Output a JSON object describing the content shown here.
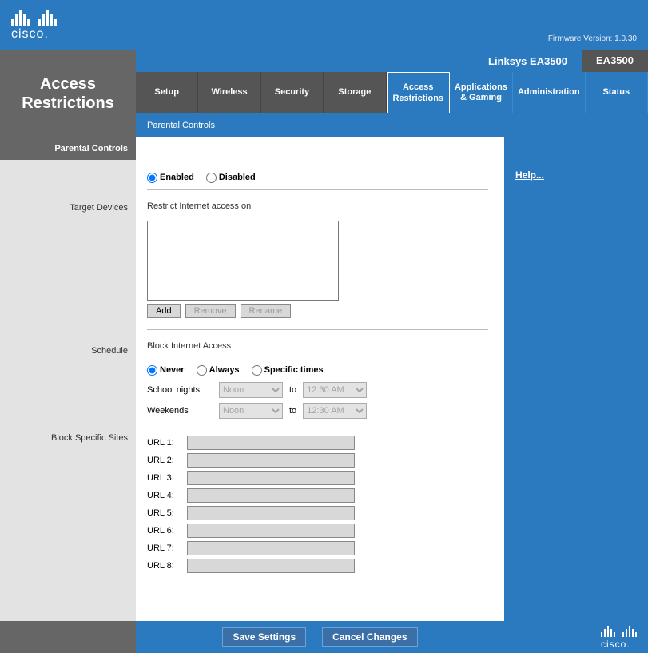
{
  "brand": {
    "name": "cisco."
  },
  "firmware": "Firmware Version: 1.0.30",
  "page_title": "Access Restrictions",
  "model": {
    "name": "Linksys EA3500",
    "code": "EA3500"
  },
  "tabs": {
    "setup": "Setup",
    "wireless": "Wireless",
    "security": "Security",
    "storage": "Storage",
    "access": "Access Restrictions",
    "apps": "Applications & Gaming",
    "admin": "Administration",
    "status": "Status"
  },
  "subnav": "Parental Controls",
  "side": {
    "parental": "Parental Controls",
    "target": "Target Devices",
    "schedule": "Schedule",
    "block": "Block Specific Sites"
  },
  "enabled_label": "Enabled",
  "disabled_label": "Disabled",
  "restrict_label": "Restrict Internet access on",
  "buttons": {
    "add": "Add",
    "remove": "Remove",
    "rename": "Rename"
  },
  "block_access_label": "Block Internet Access",
  "schedule_opts": {
    "never": "Never",
    "always": "Always",
    "specific": "Specific times"
  },
  "schedule_rows": {
    "school": "School nights",
    "weekends": "Weekends",
    "from": "Noon",
    "to_label": "to",
    "to": "12:30 AM"
  },
  "urls": {
    "u1": "URL 1:",
    "u2": "URL 2:",
    "u3": "URL 3:",
    "u4": "URL 4:",
    "u5": "URL 5:",
    "u6": "URL 6:",
    "u7": "URL 7:",
    "u8": "URL 8:"
  },
  "help": "Help...",
  "footer": {
    "save": "Save Settings",
    "cancel": "Cancel Changes"
  }
}
